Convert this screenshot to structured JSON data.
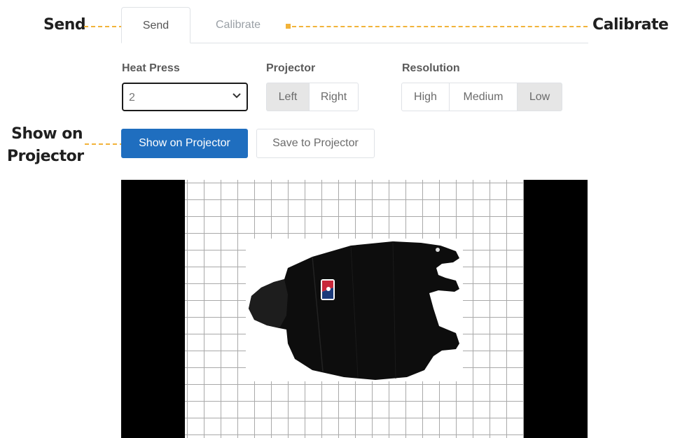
{
  "callouts": {
    "send": "Send",
    "calibrate": "Calibrate",
    "show_on_projector_line1": "Show on",
    "show_on_projector_line2": "Projector"
  },
  "tabs": [
    {
      "label": "Send",
      "active": true
    },
    {
      "label": "Calibrate",
      "active": false
    }
  ],
  "form": {
    "heat_press": {
      "label": "Heat Press",
      "value": "2"
    },
    "projector": {
      "label": "Projector",
      "options": [
        "Left",
        "Right"
      ],
      "selected": "Left"
    },
    "resolution": {
      "label": "Resolution",
      "options": [
        "High",
        "Medium",
        "Low"
      ],
      "selected": "Low"
    }
  },
  "actions": {
    "show_on_projector": "Show on Projector",
    "save_to_projector": "Save to Projector"
  },
  "preview": {
    "design_icon": "hoodie-image"
  },
  "colors": {
    "primary": "#1f6ebf",
    "callout_accent": "#f2b33a",
    "active_segment": "#e6e6e6"
  }
}
